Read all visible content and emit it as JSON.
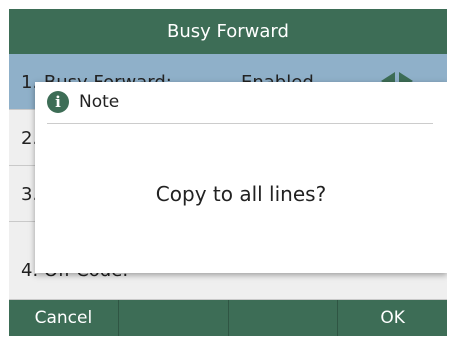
{
  "screen": {
    "title": "Busy Forward"
  },
  "list": {
    "items": [
      {
        "label": "1. Busy Forward:",
        "value": "Enabled",
        "selected": true
      },
      {
        "label": "2.",
        "value": ""
      },
      {
        "label": "3.",
        "value": ""
      },
      {
        "label": "4. Off Code:",
        "value": ""
      }
    ]
  },
  "dialog": {
    "title": "Note",
    "icon": "info-icon",
    "message": "Copy to all lines?"
  },
  "softkeys": [
    "Cancel",
    "",
    "",
    "OK"
  ],
  "colors": {
    "bar": "#3d6d56",
    "selected_row": "#8fb0c9",
    "background": "#efefef"
  }
}
